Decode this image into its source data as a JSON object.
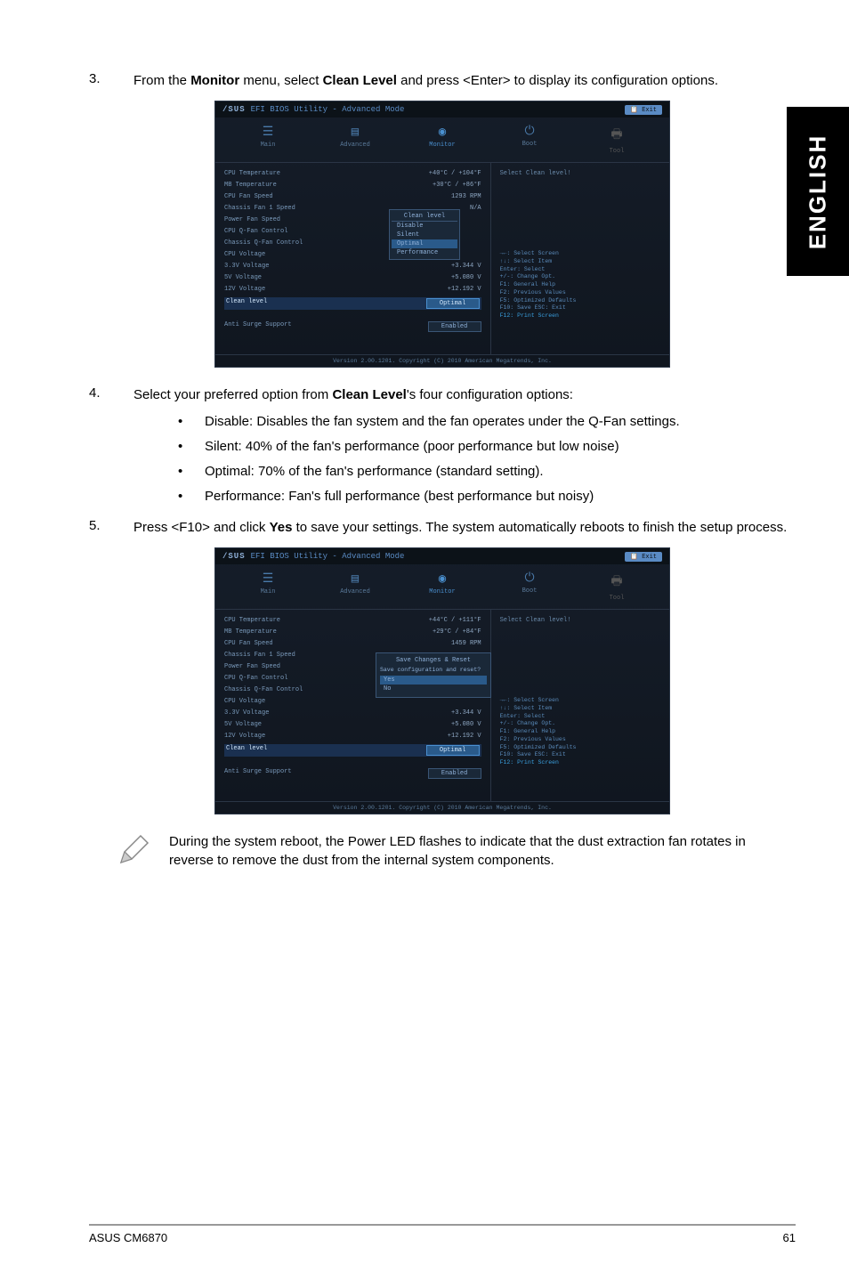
{
  "side_tab": "ENGLISH",
  "steps": {
    "s3": {
      "num": "3.",
      "text_pre": "From the ",
      "b1": "Monitor",
      "text_mid1": " menu, select ",
      "b2": "Clean Level",
      "text_post": " and press <Enter> to display its configuration options."
    },
    "s4": {
      "num": "4.",
      "text_pre": "Select your preferred option from ",
      "b1": "Clean Level",
      "text_post": "'s four configuration options:"
    },
    "s5": {
      "num": "5.",
      "text_pre": "Press <F10> and click ",
      "b1": "Yes",
      "text_post": " to save your settings. The system automatically reboots to finish the setup process."
    }
  },
  "bullets": {
    "b1": "Disable: Disables the fan system and the fan operates under the Q-Fan settings.",
    "b2": "Silent: 40% of the fan's performance (poor performance but low noise)",
    "b3": "Optimal: 70% of the fan's performance (standard setting).",
    "b4": "Performance: Fan's full performance (best performance but noisy)"
  },
  "bios": {
    "logo": "/SUS",
    "title": "EFI BIOS Utility - Advanced Mode",
    "exit": "Exit",
    "tabs": {
      "main": "Main",
      "advanced": "Advanced",
      "monitor": "Monitor",
      "boot": "Boot",
      "tool": "Tool"
    },
    "rows1": {
      "cpu_temp": {
        "l": "CPU Temperature",
        "v": "+40°C / +104°F"
      },
      "mb_temp": {
        "l": "MB Temperature",
        "v": "+30°C / +86°F"
      },
      "cpu_fan": {
        "l": "CPU Fan Speed",
        "v": "1293 RPM"
      },
      "ch_fan": {
        "l": "Chassis Fan 1 Speed",
        "v": "N/A"
      },
      "pwr_fan": {
        "l": "Power Fan Speed",
        "v": ""
      },
      "cpu_qfan": {
        "l": "CPU Q-Fan Control",
        "v": ""
      },
      "ch_qfan": {
        "l": "Chassis Q-Fan Control",
        "v": ""
      },
      "cpu_v": {
        "l": "CPU Voltage",
        "v": ""
      },
      "v33": {
        "l": "3.3V Voltage",
        "v": "+3.344 V"
      },
      "v5": {
        "l": "5V Voltage",
        "v": "+5.080 V"
      },
      "v12": {
        "l": "12V Voltage",
        "v": "+12.192 V"
      },
      "clean": {
        "l": "Clean level",
        "v": "Optimal"
      },
      "anti": {
        "l": "Anti Surge Support",
        "v": "Enabled"
      }
    },
    "rows2": {
      "cpu_temp": {
        "l": "CPU Temperature",
        "v": "+44°C / +111°F"
      },
      "mb_temp": {
        "l": "MB Temperature",
        "v": "+29°C / +84°F"
      },
      "cpu_fan": {
        "l": "CPU Fan Speed",
        "v": "1459 RPM"
      },
      "ch_fan": {
        "l": "Chassis Fan 1 Speed",
        "v": ""
      },
      "pwr_fan": {
        "l": "Power Fan Speed",
        "v": ""
      },
      "cpu_qfan": {
        "l": "CPU Q-Fan Control",
        "v": ""
      },
      "ch_qfan": {
        "l": "Chassis Q-Fan Control",
        "v": ""
      },
      "cpu_v": {
        "l": "CPU Voltage",
        "v": ""
      },
      "v33": {
        "l": "3.3V Voltage",
        "v": "+3.344 V"
      },
      "v5": {
        "l": "5V Voltage",
        "v": "+5.080 V"
      },
      "v12": {
        "l": "12V Voltage",
        "v": "+12.192 V"
      },
      "clean": {
        "l": "Clean level",
        "v": "Optimal"
      },
      "anti": {
        "l": "Anti Surge Support",
        "v": "Enabled"
      }
    },
    "dropdown": {
      "title": "Clean level",
      "o1": "Disable",
      "o2": "Silent",
      "o3": "Optimal",
      "o4": "Performance"
    },
    "dialog": {
      "title": "Save Changes & Reset",
      "q": "Save configuration and reset?",
      "yes": "Yes",
      "no": "No"
    },
    "help": {
      "title": "Select Clean level!",
      "k1": "→←: Select Screen",
      "k2": "↑↓: Select Item",
      "k3": "Enter: Select",
      "k4": "+/-: Change Opt.",
      "k5": "F1: General Help",
      "k6": "F2: Previous Values",
      "k7": "F5: Optimized Defaults",
      "k8": "F10: Save  ESC: Exit",
      "k9": "F12: Print Screen"
    },
    "footer": "Version 2.00.1201. Copyright (C) 2010 American Megatrends, Inc."
  },
  "note": "During the system reboot, the Power LED flashes to indicate that the dust extraction fan rotates in reverse to remove the dust from the internal system components.",
  "footer": {
    "left": "ASUS CM6870",
    "right": "61"
  }
}
